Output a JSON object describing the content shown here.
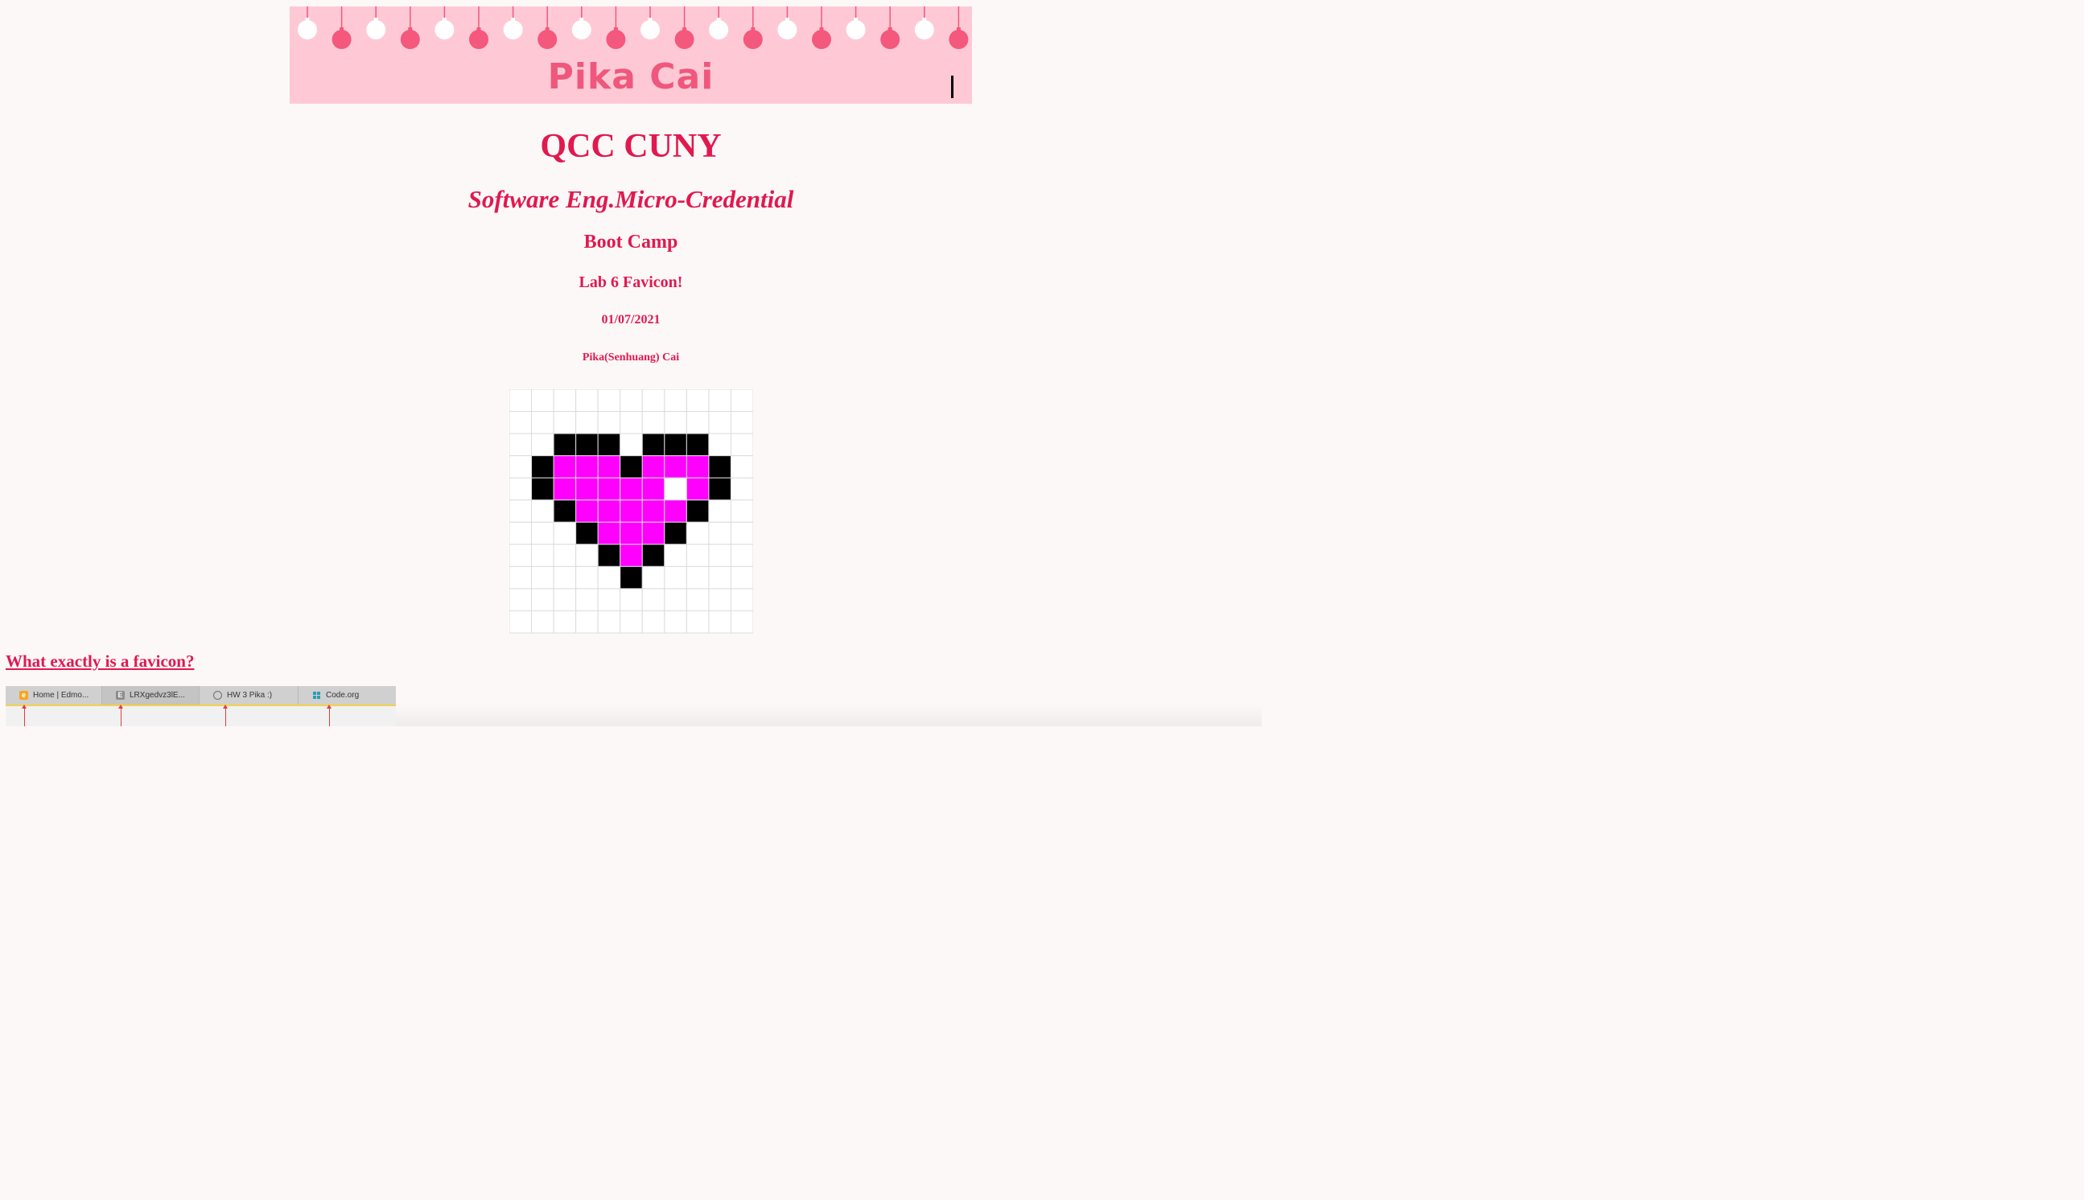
{
  "banner": {
    "title": "Pika Cai",
    "background_color": "#fec9d5",
    "title_color": "#f0577c",
    "ornament_colors": [
      "#ffffff",
      "#f4587c"
    ]
  },
  "headings": {
    "school": "QCC CUNY",
    "program": "Software Eng.Micro-Credential",
    "course": "Boot Camp",
    "lab": "Lab 6 Favicon!",
    "date": "01/07/2021",
    "author": "Pika(Senhuang) Cai"
  },
  "favicon_image": {
    "colors": {
      "k": "#000000",
      "m": "#ff00ff",
      "w": "#ffffff"
    },
    "pixel_rows": [
      "...........",
      "...........",
      "..kkk.kkk..",
      ".kmmmkmmmk.",
      ".kmmmmmwmk.",
      "..kmmmmmk..",
      "...kmmmk...",
      "....kmk....",
      ".....k.....",
      "...........",
      "..........."
    ]
  },
  "link": {
    "text": "What exactly is a favicon?"
  },
  "tab_screenshot": {
    "tabs": [
      {
        "label": "Home | Edmo...",
        "icon": "edmodo-icon",
        "icon_char": "e",
        "icon_color": "#f5a623"
      },
      {
        "label": "LRXgedvz3lE...",
        "icon": "letter-e-icon",
        "icon_char": "E",
        "icon_color": "#8c8c8c"
      },
      {
        "label": "HW 3 Pika :)",
        "icon": "compass-icon",
        "icon_char": "",
        "icon_color": "#6e6e6e"
      },
      {
        "label": "Code.org",
        "icon": "code-org-icon",
        "icon_char": "",
        "icon_color": "#2a9fb0"
      }
    ]
  }
}
